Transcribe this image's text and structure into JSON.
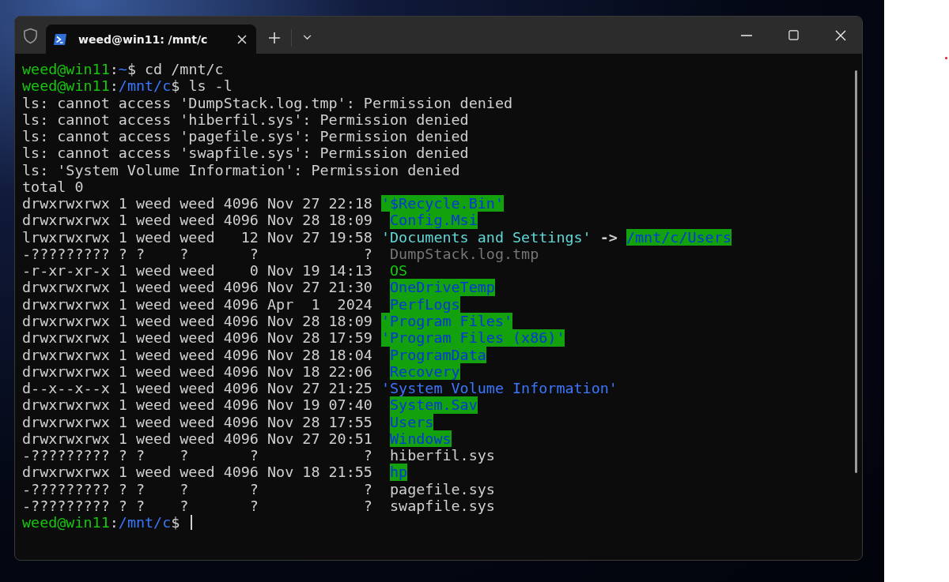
{
  "window": {
    "tab": {
      "title": "weed@win11: /mnt/c",
      "selected": true
    }
  },
  "terminal": {
    "lines": [
      {
        "segments": [
          {
            "kind": "user",
            "text": "weed@win11"
          },
          {
            "kind": "plain",
            "text": ":"
          },
          {
            "kind": "path",
            "text": "~"
          },
          {
            "kind": "plain",
            "text": "$ cd /mnt/c"
          }
        ]
      },
      {
        "segments": [
          {
            "kind": "user",
            "text": "weed@win11"
          },
          {
            "kind": "plain",
            "text": ":"
          },
          {
            "kind": "path",
            "text": "/mnt/c"
          },
          {
            "kind": "plain",
            "text": "$ ls -l"
          }
        ]
      },
      {
        "segments": [
          {
            "kind": "plain",
            "text": "ls: cannot access 'DumpStack.log.tmp': Permission denied"
          }
        ]
      },
      {
        "segments": [
          {
            "kind": "plain",
            "text": "ls: cannot access 'hiberfil.sys': Permission denied"
          }
        ]
      },
      {
        "segments": [
          {
            "kind": "plain",
            "text": "ls: cannot access 'pagefile.sys': Permission denied"
          }
        ]
      },
      {
        "segments": [
          {
            "kind": "plain",
            "text": "ls: cannot access 'swapfile.sys': Permission denied"
          }
        ]
      },
      {
        "segments": [
          {
            "kind": "plain",
            "text": "ls: 'System Volume Information': Permission denied"
          }
        ]
      },
      {
        "segments": [
          {
            "kind": "plain",
            "text": "total 0"
          }
        ]
      },
      {
        "segments": [
          {
            "kind": "meta",
            "text": "drwxrwxrwx 1 weed weed 4096 Nov 27 22:18"
          },
          {
            "kind": "dirhl",
            "text": "'$Recycle.Bin'"
          }
        ]
      },
      {
        "segments": [
          {
            "kind": "meta",
            "text": "drwxrwxrwx 1 weed weed 4096 Nov 28 18:09 "
          },
          {
            "kind": "dirhl",
            "text": "Config.Msi"
          }
        ]
      },
      {
        "segments": [
          {
            "kind": "meta",
            "text": "lrwxrwxrwx 1 weed weed   12 Nov 27 19:58"
          },
          {
            "kind": "link",
            "text": "'Documents and Settings'"
          },
          {
            "kind": "arrow",
            "text": "->"
          },
          {
            "kind": "dirhl",
            "text": "/mnt/c/Users"
          }
        ]
      },
      {
        "segments": [
          {
            "kind": "meta",
            "text": "-????????? ? ?    ?       ?            ? "
          },
          {
            "kind": "gray",
            "text": "DumpStack.log.tmp"
          }
        ]
      },
      {
        "segments": [
          {
            "kind": "meta",
            "text": "-r-xr-xr-x 1 weed weed    0 Nov 19 14:13 "
          },
          {
            "kind": "exec",
            "text": "OS"
          }
        ]
      },
      {
        "segments": [
          {
            "kind": "meta",
            "text": "drwxrwxrwx 1 weed weed 4096 Nov 27 21:30 "
          },
          {
            "kind": "dirhl",
            "text": "OneDriveTemp"
          }
        ]
      },
      {
        "segments": [
          {
            "kind": "meta",
            "text": "drwxrwxrwx 1 weed weed 4096 Apr  1  2024 "
          },
          {
            "kind": "dirhl",
            "text": "PerfLogs"
          }
        ]
      },
      {
        "segments": [
          {
            "kind": "meta",
            "text": "drwxrwxrwx 1 weed weed 4096 Nov 28 18:09"
          },
          {
            "kind": "dirhl",
            "text": "'Program Files'"
          }
        ]
      },
      {
        "segments": [
          {
            "kind": "meta",
            "text": "drwxrwxrwx 1 weed weed 4096 Nov 28 17:59"
          },
          {
            "kind": "dirhl",
            "text": "'Program Files (x86)'"
          }
        ]
      },
      {
        "segments": [
          {
            "kind": "meta",
            "text": "drwxrwxrwx 1 weed weed 4096 Nov 28 18:04 "
          },
          {
            "kind": "dirhl",
            "text": "ProgramData"
          }
        ]
      },
      {
        "segments": [
          {
            "kind": "meta",
            "text": "drwxrwxrwx 1 weed weed 4096 Nov 18 22:06 "
          },
          {
            "kind": "dirhl",
            "text": "Recovery"
          }
        ]
      },
      {
        "segments": [
          {
            "kind": "meta",
            "text": "d--x--x--x 1 weed weed 4096 Nov 27 21:25"
          },
          {
            "kind": "dir",
            "text": "'System Volume Information'"
          }
        ]
      },
      {
        "segments": [
          {
            "kind": "meta",
            "text": "drwxrwxrwx 1 weed weed 4096 Nov 19 07:40 "
          },
          {
            "kind": "dirhl",
            "text": "System.Sav"
          }
        ]
      },
      {
        "segments": [
          {
            "kind": "meta",
            "text": "drwxrwxrwx 1 weed weed 4096 Nov 28 17:55 "
          },
          {
            "kind": "dirhl",
            "text": "Users"
          }
        ]
      },
      {
        "segments": [
          {
            "kind": "meta",
            "text": "drwxrwxrwx 1 weed weed 4096 Nov 27 20:51 "
          },
          {
            "kind": "dirhl",
            "text": "Windows"
          }
        ]
      },
      {
        "segments": [
          {
            "kind": "meta",
            "text": "-????????? ? ?    ?       ?            ? "
          },
          {
            "kind": "file",
            "text": "hiberfil.sys"
          }
        ]
      },
      {
        "segments": [
          {
            "kind": "meta",
            "text": "drwxrwxrwx 1 weed weed 4096 Nov 18 21:55 "
          },
          {
            "kind": "dirhl",
            "text": "hp"
          }
        ]
      },
      {
        "segments": [
          {
            "kind": "meta",
            "text": "-????????? ? ?    ?       ?            ? "
          },
          {
            "kind": "file",
            "text": "pagefile.sys"
          }
        ]
      },
      {
        "segments": [
          {
            "kind": "meta",
            "text": "-????????? ? ?    ?       ?            ? "
          },
          {
            "kind": "file",
            "text": "swapfile.sys"
          }
        ]
      },
      {
        "segments": [
          {
            "kind": "user",
            "text": "weed@win11"
          },
          {
            "kind": "plain",
            "text": ":"
          },
          {
            "kind": "path",
            "text": "/mnt/c"
          },
          {
            "kind": "plain",
            "text": "$"
          },
          {
            "kind": "cursor"
          }
        ]
      }
    ]
  }
}
